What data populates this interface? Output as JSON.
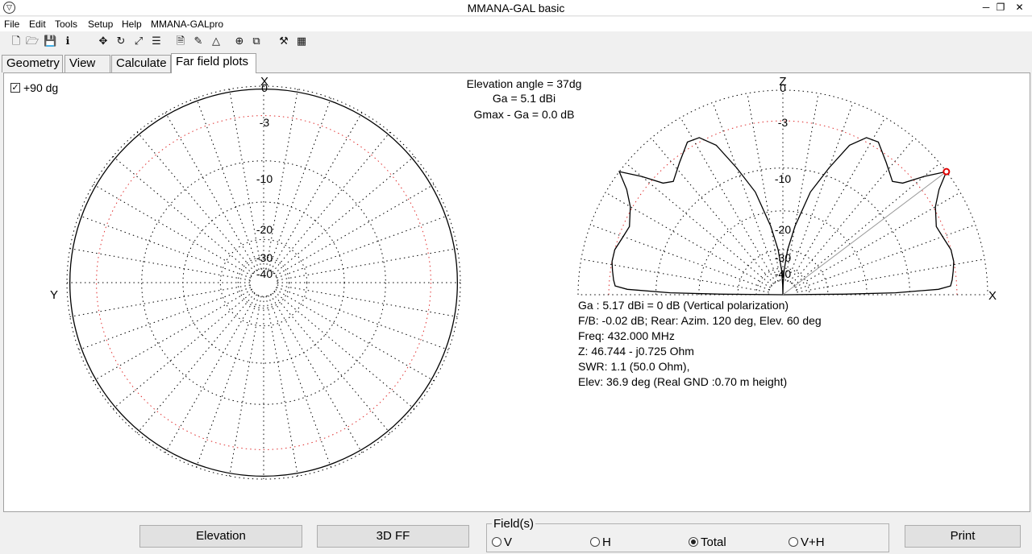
{
  "window": {
    "title": "MMANA-GAL basic",
    "icon": "mmana-logo-icon",
    "minimize": "─",
    "maximize": "❐",
    "close": "✕"
  },
  "menu": [
    "File",
    "Edit",
    "Tools",
    "Setup",
    "Help",
    "MMANA-GALpro"
  ],
  "toolbar": [
    {
      "name": "new-file-icon",
      "glyph": "🗋"
    },
    {
      "name": "open-folder-icon",
      "glyph": "🗁"
    },
    {
      "name": "save-icon",
      "glyph": "💾"
    },
    {
      "name": "info-icon",
      "glyph": "ℹ"
    },
    {
      "name": "move-icon",
      "glyph": "✥"
    },
    {
      "name": "rotate-icon",
      "glyph": "↻"
    },
    {
      "name": "scale-icon",
      "glyph": "⤢"
    },
    {
      "name": "segments-icon",
      "glyph": "☰"
    },
    {
      "name": "document-icon",
      "glyph": "🗎"
    },
    {
      "name": "wire-edit-icon",
      "glyph": "✎"
    },
    {
      "name": "triangle-icon",
      "glyph": "△"
    },
    {
      "name": "target-icon",
      "glyph": "⊕"
    },
    {
      "name": "copy-icon",
      "glyph": "⧉"
    },
    {
      "name": "tools-icon",
      "glyph": "⚒"
    },
    {
      "name": "calculator-icon",
      "glyph": "▦"
    }
  ],
  "tabs": [
    "Geometry",
    "View",
    "Calculate",
    "Far field plots"
  ],
  "active_tab": "Far field plots",
  "plot": {
    "checkbox_mark": "✓",
    "checkbox_label": "+90 dg",
    "elevation_angle": "Elevation angle =  37dg",
    "ga": "Ga = 5.1 dBi",
    "gmax_ga": "Gmax - Ga = 0.0 dB",
    "left_axis_top": "X",
    "left_axis_left": "Y",
    "right_axis_top": "Z",
    "right_axis_right": "X",
    "ring_labels": [
      "0",
      "-3",
      "-10",
      "-20",
      "-30",
      "-40"
    ],
    "info_lines": [
      "Ga : 5.17 dBi = 0 dB  (Vertical polarization)",
      "F/B: -0.02 dB; Rear: Azim. 120 deg,  Elev. 60 deg",
      "Freq: 432.000 MHz",
      "Z: 46.744 - j0.725 Ohm",
      "SWR: 1.1 (50.0 Ohm),",
      "Elev: 36.9 deg (Real GND  :0.70 m height)"
    ],
    "colors": {
      "grid": "#000000",
      "ref_ring": "#e03030",
      "pattern": "#000000",
      "marker": "#e00000",
      "pointer": "#999999"
    }
  },
  "bottom": {
    "elevation_btn": "Elevation",
    "ff3d_btn": "3D FF",
    "field_legend": "Field(s)",
    "radios": [
      {
        "label": "V",
        "checked": false
      },
      {
        "label": "H",
        "checked": false
      },
      {
        "label": "Total",
        "checked": true
      },
      {
        "label": "V+H",
        "checked": false
      }
    ],
    "print_btn": "Print"
  }
}
